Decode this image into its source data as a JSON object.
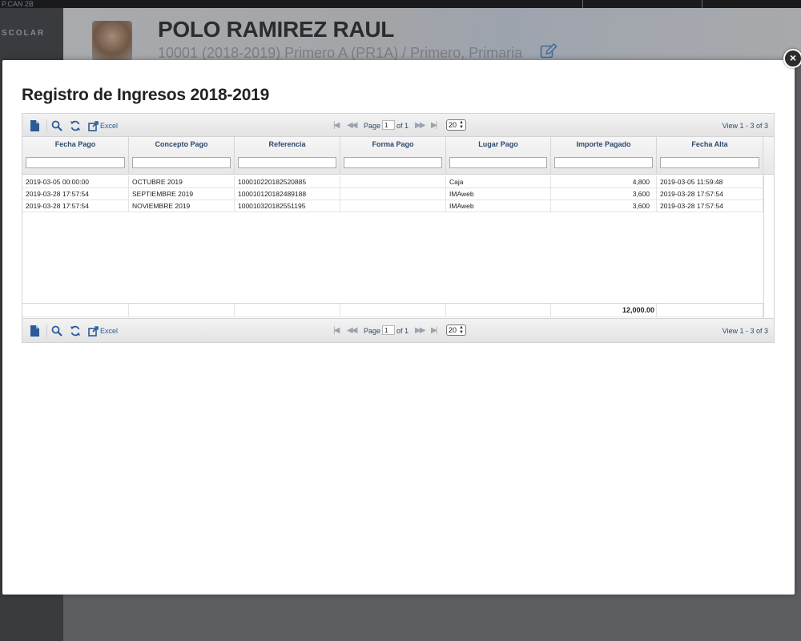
{
  "background": {
    "sidebar_top_text": "P.CAN 2B",
    "sidebar_nav_text": "SCOLAR",
    "student_name": "POLO RAMIREZ RAUL",
    "student_sub": "10001 (2018-2019) Primero A (PR1A) / Primero, Primaria"
  },
  "modal": {
    "title": "Registro de Ingresos 2018-2019",
    "close_label": "×"
  },
  "pager": {
    "excel_label": "Excel",
    "page_label": "Page",
    "page_value": "1",
    "of_label": "of 1",
    "rows_per_page": "20",
    "view_label": "View 1 - 3 of 3"
  },
  "grid": {
    "columns": [
      "Fecha Pago",
      "Concepto Pago",
      "Referencia",
      "Forma Pago",
      "Lugar Pago",
      "Importe Pagado",
      "Fecha Alta"
    ],
    "rows": [
      [
        "2019-03-05 00:00:00",
        "OCTUBRE 2019",
        "100010220182520885",
        "",
        "Caja",
        "4,800",
        "2019-03-05 11:59:48"
      ],
      [
        "2019-03-28 17:57:54",
        "SEPTIEMBRE 2019",
        "100010120182489188",
        "",
        "IMAweb",
        "3,600",
        "2019-03-28 17:57:54"
      ],
      [
        "2019-03-28 17:57:54",
        "NOVIEMBRE 2019",
        "100010320182551195",
        "",
        "IMAweb",
        "3,600",
        "2019-03-28 17:57:54"
      ]
    ],
    "total": "12,000.00"
  },
  "colors": {
    "header_text": "#2c4a6e",
    "icon_blue": "#2b5b9a"
  },
  "icons": [
    "new-record-icon",
    "search-icon",
    "refresh-icon",
    "export-excel-icon",
    "first-page-icon",
    "prev-page-icon",
    "next-page-icon",
    "last-page-icon",
    "close-icon",
    "edit-icon"
  ]
}
